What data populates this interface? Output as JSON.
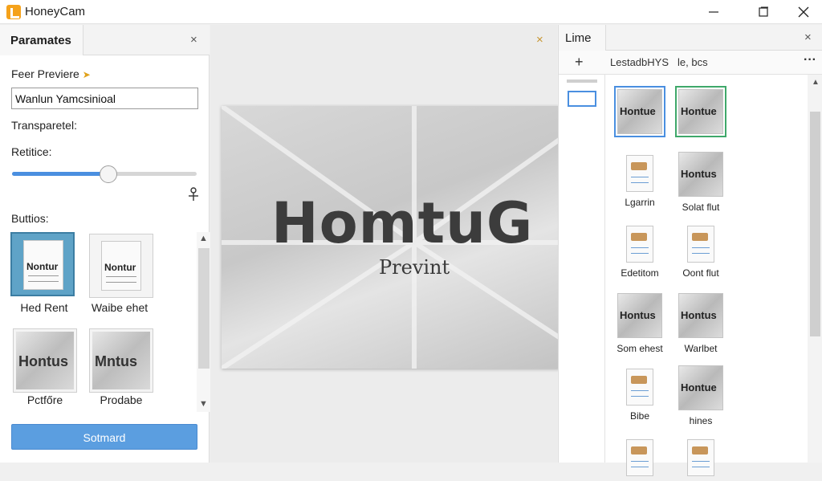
{
  "app": {
    "title": "HoneyCam"
  },
  "window_controls": {
    "minimize": "—",
    "close": "✕"
  },
  "left_panel": {
    "tab_title": "Paramates",
    "close": "×",
    "preview_label": "Feer Previere",
    "input_value": "Wanlun Yamcsinioal",
    "transparency_label": "Transparetel:",
    "resize_label": "Retitice:",
    "slider_value": 0.52,
    "buttons_label": "Buttios:",
    "tiles": [
      {
        "kind": "doc",
        "text": "Nontur",
        "caption": "Hed Rent",
        "selected": true
      },
      {
        "kind": "doc",
        "text": "Nontur",
        "caption": "Waibe ehet",
        "selected": false
      },
      {
        "kind": "img",
        "text": "Hontus",
        "caption": "Pctfőre",
        "selected": false
      },
      {
        "kind": "img",
        "text": "Mntus",
        "caption": "Prodabe",
        "selected": false
      }
    ],
    "primary_button": "Sotmard"
  },
  "center": {
    "close": "×",
    "preview_big": "HomtuG",
    "preview_small": "Prevint"
  },
  "right_panel": {
    "tab_title": "Lime",
    "close": "×",
    "add": "+",
    "tool_1": "LestadbHYS",
    "tool_2": "le, bcs",
    "more": "···",
    "items": [
      {
        "kind": "img",
        "text": "Hontue",
        "caption": "",
        "sel": "blue"
      },
      {
        "kind": "img",
        "text": "Hontue",
        "caption": "",
        "sel": "green"
      },
      {
        "kind": "doc",
        "text": "",
        "caption": "Lgarrin",
        "sel": ""
      },
      {
        "kind": "img",
        "text": "Hontus",
        "caption": "Solat flut",
        "sel": ""
      },
      {
        "kind": "doc",
        "text": "",
        "caption": "Edetitom",
        "sel": ""
      },
      {
        "kind": "doc",
        "text": "",
        "caption": "Oont flut",
        "sel": ""
      },
      {
        "kind": "img",
        "text": "Hontus",
        "caption": "Som ehest",
        "sel": ""
      },
      {
        "kind": "img",
        "text": "Hontus",
        "caption": "Warlbet",
        "sel": ""
      },
      {
        "kind": "doc",
        "text": "",
        "caption": "Bibe",
        "sel": ""
      },
      {
        "kind": "img",
        "text": "Hontue",
        "caption": "hines",
        "sel": ""
      },
      {
        "kind": "doc",
        "text": "",
        "caption": "",
        "sel": ""
      },
      {
        "kind": "doc",
        "text": "",
        "caption": "",
        "sel": ""
      }
    ]
  },
  "colors": {
    "accent": "#4a8fe0",
    "button": "#5b9ee0",
    "app_icon": "#f5a21b",
    "green_select": "#3fa86a"
  }
}
